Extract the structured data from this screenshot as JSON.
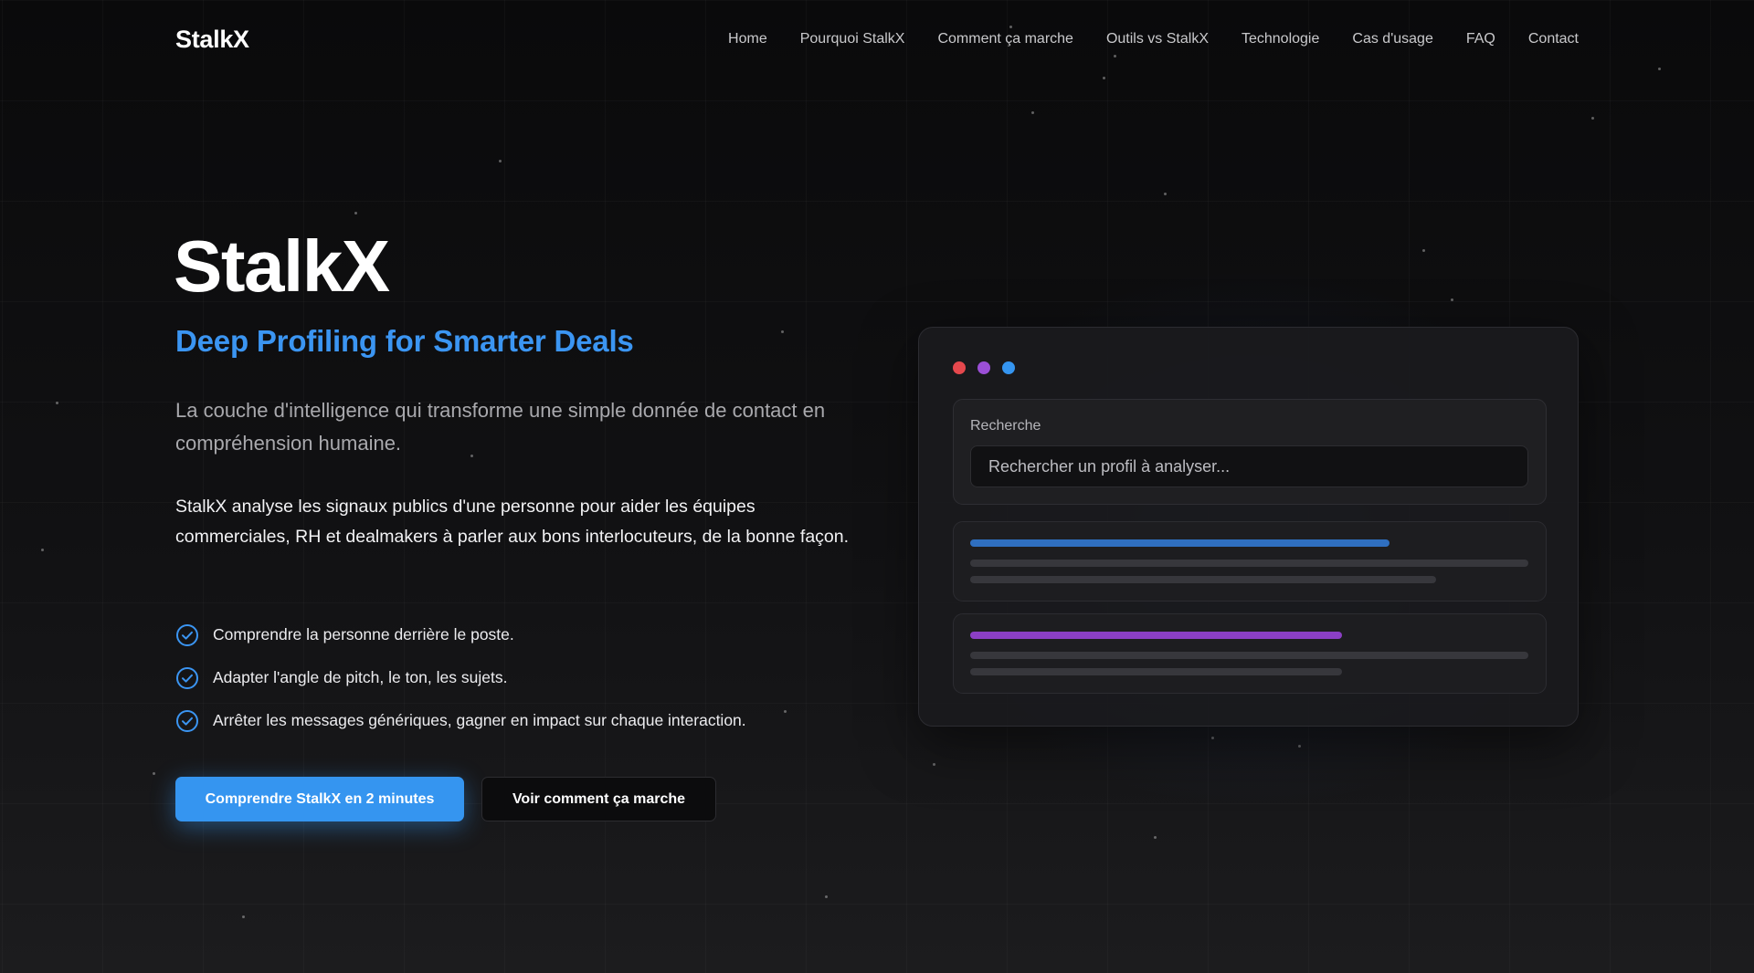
{
  "nav": {
    "brand": "StalkX",
    "links": [
      "Home",
      "Pourquoi StalkX",
      "Comment ça marche",
      "Outils vs StalkX",
      "Technologie",
      "Cas d'usage",
      "FAQ",
      "Contact"
    ]
  },
  "hero": {
    "title": "StalkX",
    "tagline": "Deep Profiling for Smarter Deals",
    "lead": "La couche d'intelligence qui transforme une simple donnée de contact en compréhension humaine.",
    "description": "StalkX analyse les signaux publics d'une personne pour aider les équipes commerciales, RH et dealmakers à parler aux bons interlocuteurs, de la bonne façon.",
    "bullets": [
      "Comprendre la personne derrière le poste.",
      "Adapter l'angle de pitch, le ton, les sujets.",
      "Arrêter les messages génériques, gagner en impact sur chaque interaction."
    ],
    "primary_cta": "Comprendre StalkX en 2 minutes",
    "secondary_cta": "Voir comment ça marche"
  },
  "mockup": {
    "search_label": "Recherche",
    "search_placeholder": "Rechercher un profil à analyser...",
    "window_dots": [
      "#e5484d",
      "#9b4fd6",
      "#3595f0"
    ]
  },
  "colors": {
    "accent": "#3b95f2",
    "button": "#3595f0",
    "result_bar_blue": "#2f6fc0",
    "result_bar_purple": "#8b3fc4"
  }
}
